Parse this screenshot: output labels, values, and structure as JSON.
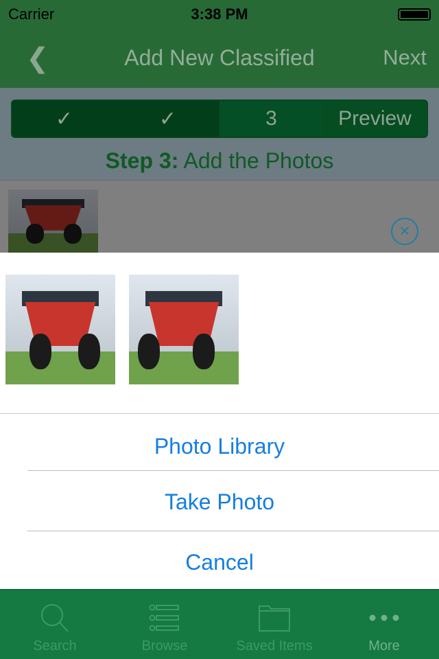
{
  "status": {
    "carrier": "Carrier",
    "time": "3:38 PM"
  },
  "nav": {
    "back_icon": "chevron-left",
    "title": "Add New Classified",
    "next": "Next"
  },
  "steps": {
    "items": [
      "✓",
      "✓",
      "3",
      "Preview"
    ],
    "current": 2
  },
  "step_title": {
    "bold": "Step 3:",
    "text": "Add the Photos"
  },
  "sheet": {
    "photo_library": "Photo Library",
    "take_photo": "Take Photo",
    "cancel": "Cancel"
  },
  "tabs": [
    {
      "label": "Search",
      "icon": "search-icon"
    },
    {
      "label": "Browse",
      "icon": "list-icon"
    },
    {
      "label": "Saved Items",
      "icon": "folder-icon"
    },
    {
      "label": "More",
      "icon": "more-icon"
    }
  ],
  "colors": {
    "nav": "#286a36",
    "tabbar": "#157942",
    "action": "#157ee0"
  }
}
